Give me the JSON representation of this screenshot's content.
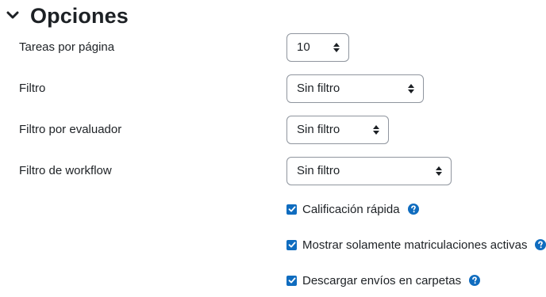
{
  "section": {
    "title": "Opciones",
    "toggle_icon": "chevron-down-icon"
  },
  "fields": {
    "per_page": {
      "label": "Tareas por página",
      "value": "10"
    },
    "filter": {
      "label": "Filtro",
      "value": "Sin filtro"
    },
    "marker_filter": {
      "label": "Filtro por evaluador",
      "value": "Sin filtro"
    },
    "workflow_filter": {
      "label": "Filtro de workflow",
      "value": "Sin filtro"
    }
  },
  "checkboxes": {
    "quick_grading": {
      "label": "Calificación rápida",
      "checked": true,
      "help_icon": "question-circle-icon"
    },
    "active_only": {
      "label": "Mostrar solamente matriculaciones activas",
      "checked": true,
      "help_icon": "question-circle-icon"
    },
    "download_folders": {
      "label": "Descargar envíos en carpetas",
      "checked": true,
      "help_icon": "question-circle-icon"
    }
  },
  "colors": {
    "accent": "#0f6cbf",
    "help": "#0f6cbf",
    "text": "#1d2125",
    "border": "#8f959e"
  }
}
